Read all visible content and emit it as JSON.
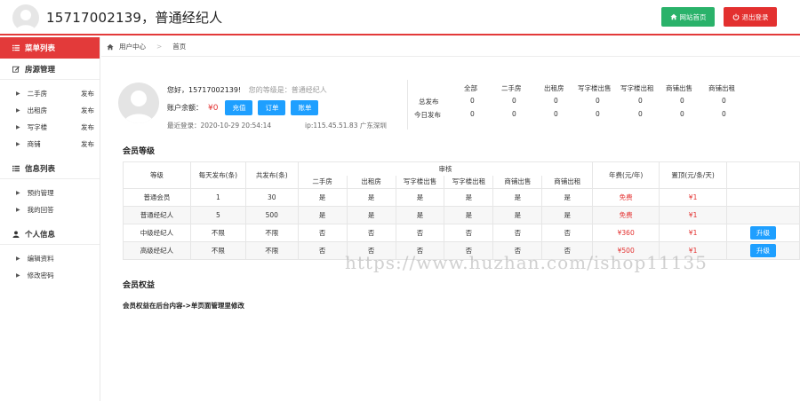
{
  "header": {
    "title": "15717002139，普通经纪人",
    "site_home_label": "网站首页",
    "logout_label": "退出登录",
    "home_icon": "home-icon",
    "power_icon": "power-icon"
  },
  "sidebar": {
    "menu_title": "菜单列表",
    "groups": [
      {
        "label": "房源管理",
        "icon": "edit-icon"
      },
      {
        "label": "信息列表",
        "icon": "list-icon"
      },
      {
        "label": "个人信息",
        "icon": "user-icon"
      }
    ],
    "property_items": [
      {
        "label": "二手房",
        "action": "发布"
      },
      {
        "label": "出租房",
        "action": "发布"
      },
      {
        "label": "写字楼",
        "action": "发布"
      },
      {
        "label": "商铺",
        "action": "发布"
      }
    ],
    "info_items": [
      {
        "label": "预约管理"
      },
      {
        "label": "我的回答"
      }
    ],
    "personal_items": [
      {
        "label": "编辑资料"
      },
      {
        "label": "修改密码"
      }
    ]
  },
  "breadcrumb": {
    "user_center": "用户中心",
    "home": "首页"
  },
  "profile": {
    "greeting": "您好，15717002139!",
    "level_text": "您的等级是：普通经纪人",
    "balance_label": "账户余额：",
    "balance_value": "¥0",
    "recharge_label": "充值",
    "orders_label": "订单",
    "bills_label": "账单",
    "last_login": "最近登录：2020-10-29 20:54:14",
    "ip_location": "ip:115.45.51.83 广东深圳"
  },
  "stats": {
    "columns": [
      "全部",
      "二手房",
      "出租房",
      "写字楼出售",
      "写字楼出租",
      "商铺出售",
      "商铺出租"
    ],
    "rows": [
      {
        "label": "总发布",
        "values": [
          "0",
          "0",
          "0",
          "0",
          "0",
          "0",
          "0"
        ]
      },
      {
        "label": "今日发布",
        "values": [
          "0",
          "0",
          "0",
          "0",
          "0",
          "0",
          "0"
        ]
      }
    ]
  },
  "membership": {
    "section_title": "会员等级",
    "headers": {
      "level": "等级",
      "daily": "每天发布(条)",
      "total": "共发布(条)",
      "review": "审核",
      "review_cols": [
        "二手房",
        "出租房",
        "写字楼出售",
        "写字楼出租",
        "商铺出售",
        "商铺出租"
      ],
      "annual": "年费(元/年)",
      "top": "置顶(元/条/天)"
    },
    "rows": [
      {
        "level": "普通会员",
        "daily": "1",
        "total": "30",
        "review": [
          "是",
          "是",
          "是",
          "是",
          "是",
          "是"
        ],
        "annual": "免费",
        "top": "¥1",
        "action": ""
      },
      {
        "level": "普通经纪人",
        "daily": "5",
        "total": "500",
        "review": [
          "是",
          "是",
          "是",
          "是",
          "是",
          "是"
        ],
        "annual": "免费",
        "top": "¥1",
        "action": ""
      },
      {
        "level": "中级经纪人",
        "daily": "不限",
        "total": "不限",
        "review": [
          "否",
          "否",
          "否",
          "否",
          "否",
          "否"
        ],
        "annual": "¥360",
        "top": "¥1",
        "action": "升级"
      },
      {
        "level": "高级经纪人",
        "daily": "不限",
        "total": "不限",
        "review": [
          "否",
          "否",
          "否",
          "否",
          "否",
          "否"
        ],
        "annual": "¥500",
        "top": "¥1",
        "action": "升级"
      }
    ]
  },
  "rights": {
    "section_title": "会员权益",
    "text": "会员权益在后台内容->单页面管理里修改"
  },
  "watermark": "https://www.huzhan.com/ishop11135",
  "colors": {
    "accent_red": "#e33a3a",
    "green": "#2ab26a",
    "blue": "#1e9fff"
  }
}
